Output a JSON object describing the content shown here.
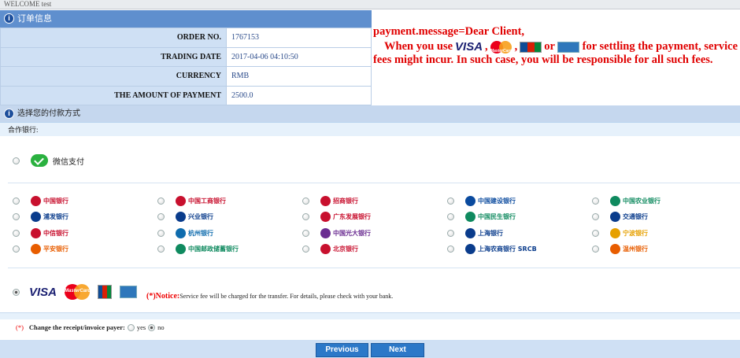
{
  "topbar": {
    "welcome": "WELCOME test"
  },
  "order": {
    "header": "订单信息",
    "rows": [
      {
        "label": "ORDER NO.",
        "value": "1767153"
      },
      {
        "label": "TRADING DATE",
        "value": "2017-04-06 04:10:50"
      },
      {
        "label": "CURRENCY",
        "value": "RMB"
      },
      {
        "label": "THE AMOUNT OF PAYMENT",
        "value": "2500.0"
      }
    ]
  },
  "message": {
    "line1": "payment.message=Dear Client,",
    "when": "When you use",
    "sep1": ",",
    "sep2": ",",
    "or": "or",
    "rest": "for settling the payment, service fees might incur. In such case, you will be responsible for all such fees.",
    "visa": "VISA",
    "mastercard": "MasterCard"
  },
  "payment_method": {
    "header": "选择您的付款方式",
    "banks_label": "合作银行:",
    "wechat": "微信支付",
    "banks": [
      {
        "name": "中国银行",
        "color": "#c8102e"
      },
      {
        "name": "中国工商银行",
        "color": "#c8102e"
      },
      {
        "name": "招商银行",
        "color": "#c8102e"
      },
      {
        "name": "中国建设银行",
        "color": "#0a4a9e"
      },
      {
        "name": "中国农业银行",
        "color": "#0f8a5f"
      },
      {
        "name": "浦发银行",
        "color": "#0a3c8c"
      },
      {
        "name": "兴业银行",
        "color": "#0a3c8c"
      },
      {
        "name": "广东发展银行",
        "color": "#c8102e"
      },
      {
        "name": "中国民生银行",
        "color": "#0f8a5f"
      },
      {
        "name": "交通银行",
        "color": "#0a3c8c"
      },
      {
        "name": "中信银行",
        "color": "#c8102e"
      },
      {
        "name": "杭州银行",
        "color": "#0f6cae"
      },
      {
        "name": "中国光大银行",
        "color": "#6a2c91"
      },
      {
        "name": "上海银行",
        "color": "#0a3c8c"
      },
      {
        "name": "宁波银行",
        "color": "#e6a000"
      },
      {
        "name": "平安银行",
        "color": "#e85d00"
      },
      {
        "name": "中国邮政储蓄银行",
        "color": "#0f8a5f"
      },
      {
        "name": "北京银行",
        "color": "#c8102e"
      },
      {
        "name": "上海农商银行 SRCB",
        "color": "#0a3c8c"
      },
      {
        "name": "温州银行",
        "color": "#e85d00"
      }
    ],
    "cards": {
      "visa": "VISA",
      "mastercard": "MasterCard"
    },
    "notice_label": "(*)Notice:",
    "notice_text": "Service fee will be charged for the transfer. For details, please check with your bank."
  },
  "receipt": {
    "required": "(*)",
    "label": "Change the receipt/invoice payer:",
    "yes": "yes",
    "no": "no",
    "selected": "no"
  },
  "buttons": {
    "previous": "Previous",
    "next": "Next"
  },
  "colors": {
    "accent": "#2c78c8",
    "header": "#5f8fce",
    "alert": "#e00000"
  }
}
